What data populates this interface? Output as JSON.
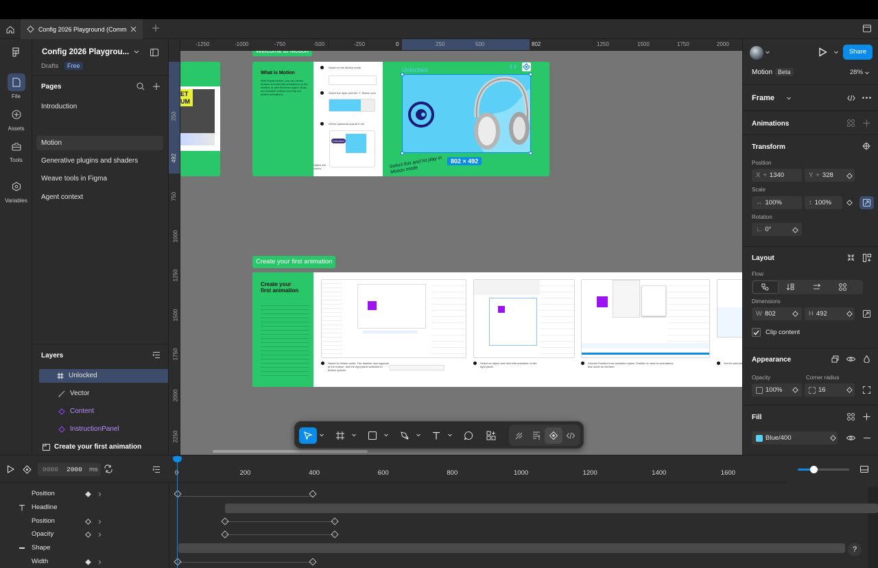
{
  "tab": {
    "title": "Config 2026 Playground (Commu"
  },
  "rail": {
    "file": "File",
    "assets": "Assets",
    "tools": "Tools",
    "variables": "Variables"
  },
  "file": {
    "name": "Config 2026 Playgrou...",
    "location": "Drafts",
    "plan": "Free"
  },
  "pages": {
    "header": "Pages",
    "items": [
      "Introduction",
      "Motion",
      "Generative plugins and shaders",
      "Weave tools in Figma",
      "Agent context"
    ],
    "selected": "Motion"
  },
  "layers": {
    "header": "Layers",
    "items": [
      {
        "name": "Unlocked",
        "icon": "frame-hash-icon"
      },
      {
        "name": "Vector",
        "icon": "vector-icon"
      },
      {
        "name": "Content",
        "icon": "component-instance-icon"
      },
      {
        "name": "InstructionPanel",
        "icon": "component-instance-icon"
      },
      {
        "name": "Create your first animation",
        "icon": "section-icon"
      }
    ]
  },
  "ruler": {
    "h": [
      "-1250",
      "-1000",
      "-750",
      "-500",
      "-250",
      "0",
      "250",
      "500",
      "802",
      "1250",
      "1500",
      "1750",
      "2000"
    ],
    "v": [
      "250",
      "492",
      "750",
      "1000",
      "1250",
      "1500",
      "1750",
      "2000",
      "2250"
    ]
  },
  "canvas": {
    "sec1": {
      "label": "Welcome to Motion",
      "panel_title": "What is Motion",
      "panel_text": "With Figma Motion, you can create, browse and animate animations on the timeline or with Sketches Agent. Build out reusable motions and slip our motion animations.",
      "steps": [
        "Switch to the Motion mode",
        "Select the layer with the \"t\" Motion icon",
        "Hit the spacebar and let it roll"
      ],
      "mini_chip": "Unlocked",
      "handnote": "Select this and hit play in Motion mode",
      "frame_label": "Unlocked",
      "dims": "802 × 492",
      "note2": "Watch the cursor"
    },
    "sec2": {
      "label": "Create your first animation",
      "panel_title": "Create your first animation",
      "captions": [
        "Switch to Motion mode. The timeline view appears at the bottom, and the right panel switches to Motion options.",
        "Select an object and click Add animation in the right panel.",
        "Choose Position from animation styles. Position is used for animations that move an element.",
        "Set the animation..."
      ]
    },
    "left_frame_text": "ET UM"
  },
  "toolbar": {
    "items": [
      "move-tool-icon",
      "frame-tool-icon",
      "rectangle-tool-icon",
      "pen-tool-icon",
      "text-tool-icon",
      "comment-tool-icon",
      "actions-tool-icon",
      "draw-mode-icon",
      "design-mode-icon",
      "motion-mode-icon",
      "dev-mode-icon"
    ]
  },
  "right": {
    "share": "Share",
    "mode": "Motion",
    "badge": "Beta",
    "zoom": "28%",
    "frame": "Frame",
    "animations": "Animations",
    "transform": "Transform",
    "position_label": "Position",
    "x": "1340",
    "y": "328",
    "x_key": "X",
    "y_key": "Y",
    "scale_label": "Scale",
    "scale_w": "100%",
    "scale_h": "100%",
    "rotation_label": "Rotation",
    "rotation": "0°",
    "layout": "Layout",
    "flow_label": "Flow",
    "dimensions_label": "Dimensions",
    "w": "802",
    "h": "492",
    "w_key": "W",
    "h_key": "H",
    "clip": "Clip content",
    "appearance": "Appearance",
    "opacity_label": "Opacity",
    "opacity": "100%",
    "radius_label": "Corner radius",
    "radius": "16",
    "fill": "Fill",
    "fill_name": "Blue/400",
    "fill_color": "#5bcff5"
  },
  "timeline": {
    "start": "0000",
    "end": "2000",
    "unit": "ms",
    "ticks": [
      "0",
      "200",
      "400",
      "600",
      "800",
      "1000",
      "1200",
      "1400",
      "1600"
    ],
    "rows": [
      {
        "label": "Position",
        "indent": true
      },
      {
        "label": "Headline",
        "indent": false
      },
      {
        "label": "Position",
        "indent": true
      },
      {
        "label": "Opacity",
        "indent": true
      },
      {
        "label": "Shape",
        "indent": false
      },
      {
        "label": "Width",
        "indent": true
      }
    ],
    "zoom_level": 0.3
  },
  "colors": {
    "green": "#2ac76a",
    "blue": "#5bcff5",
    "accent": "#0c8ce9",
    "purple": "#9747ff"
  }
}
